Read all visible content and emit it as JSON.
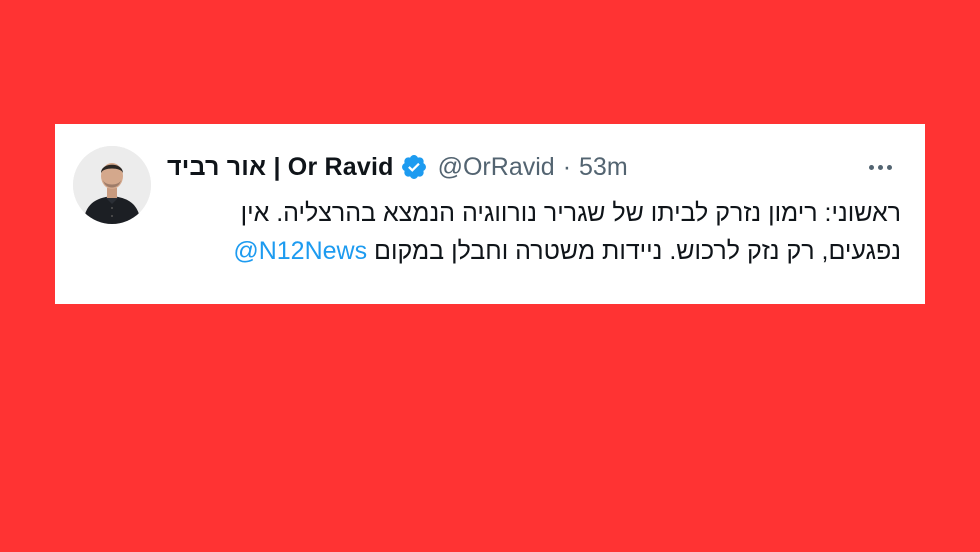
{
  "page": {
    "background_color": "#ff3333"
  },
  "tweet": {
    "display_name": "אור רביד | Or Ravid",
    "verified_icon": "verified-badge-icon",
    "verified_color": "#1d9bf0",
    "handle": "@OrRavid",
    "separator": "·",
    "time": "53m",
    "more_icon": "more-dots-icon",
    "text_line_1": "ראשוני: רימון נזרק לביתו של שגריר נורווגיה הנמצא בהרצליה. אין",
    "text_line_2": "נפגעים, רק נזק לרכוש. ניידות משטרה וחבלן במקום",
    "mention": "@N12News",
    "mention_color": "#1d9bf0"
  }
}
